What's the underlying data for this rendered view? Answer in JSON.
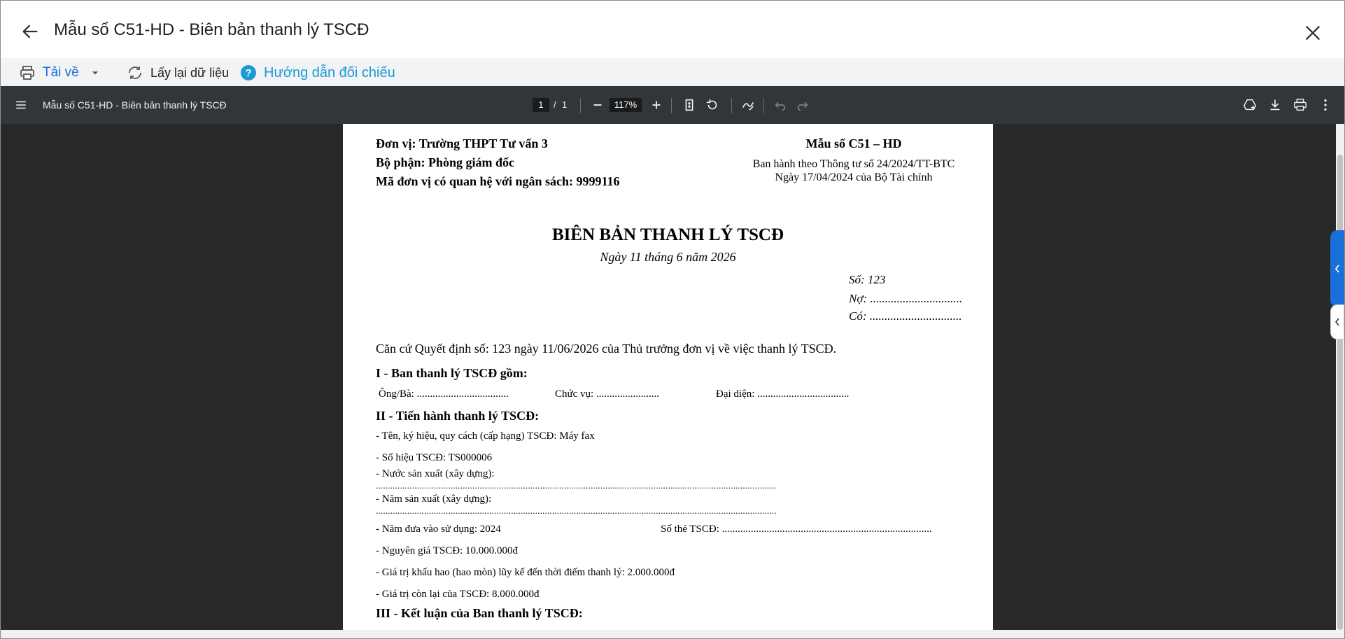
{
  "header": {
    "title": "Mẫu số C51-HD - Biên bản thanh lý TSCĐ"
  },
  "toolbar": {
    "print_label": "Tải về",
    "reload_label": "Lấy lại dữ liệu",
    "guide_label": "Hướng dẫn đối chiếu"
  },
  "viewer": {
    "title": "Mẫu số C51-HD - Biên bản thanh lý TSCĐ",
    "page_current": "1",
    "page_sep": "/",
    "page_total": "1",
    "zoom": "117%"
  },
  "icons": [
    "back-arrow-icon",
    "close-icon",
    "printer-icon",
    "chevron-down-icon",
    "reload-icon",
    "help-circle-icon",
    "menu-icon",
    "minus-icon",
    "plus-icon",
    "fit-page-icon",
    "rotate-icon",
    "annotate-icon",
    "undo-icon",
    "redo-icon",
    "drive-save-icon",
    "download-icon",
    "print-icon",
    "more-vert-icon",
    "chevron-left-icon"
  ],
  "document": {
    "don_vi": "Đơn vị: Trường THPT Tư vấn 3",
    "bo_phan": "Bộ phận: Phòng giám đốc",
    "ma_don_vi": "Mã đơn vị có quan hệ với ngân sách: 9999116",
    "mau_so": "Mẫu số C51 – HD",
    "ban_hanh": "Ban hành theo Thông tư số 24/2024/TT-BTC",
    "ngay_ban_hanh": "Ngày 17/04/2024 của Bộ Tài chính",
    "heading": "BIÊN BẢN THANH LÝ TSCĐ",
    "date": "Ngày 11 tháng 6 năm 2026",
    "so": "Số: 123",
    "no": "Nợ: ...............................",
    "co": "Có: ...............................",
    "can_cu": "Căn cứ Quyết định số: 123 ngày 11/06/2026 của Thủ trưởng đơn vị về việc thanh lý TSCĐ.",
    "section1": "I - Ban thanh lý TSCĐ gồm:",
    "ong_ba": "Ông/Bà: ...................................",
    "chuc_vu": "Chức vụ: ........................",
    "dai_dien": "Đại diện: ...................................",
    "section2": "II - Tiến hành thanh lý TSCĐ:",
    "ten": "- Tên, ký hiệu, quy cách (cấp hạng) TSCĐ: Máy fax",
    "so_hieu": "- Số hiệu TSCĐ: TS000006",
    "nuoc_sx": "- Nước sản xuất (xây dựng):",
    "dots1": "......................................................................................................................................................................",
    "nam_sx": "- Năm sản xuất (xây dựng):",
    "dots2": "......................................................................................................................................................................",
    "nam_dua": "- Năm đưa vào sử dụng: 2024",
    "so_the": "Số thẻ TSCĐ: ................................................................................",
    "nguyen_gia": "- Nguyên giá TSCĐ: 10.000.000đ",
    "khau_hao": "- Giá trị khấu hao (hao mòn) lũy kế đến thời điểm thanh lý: 2.000.000đ",
    "con_lai": "- Giá trị còn lại của TSCĐ: 8.000.000đ",
    "section3": "III - Kết luận của Ban thanh lý TSCĐ:"
  }
}
